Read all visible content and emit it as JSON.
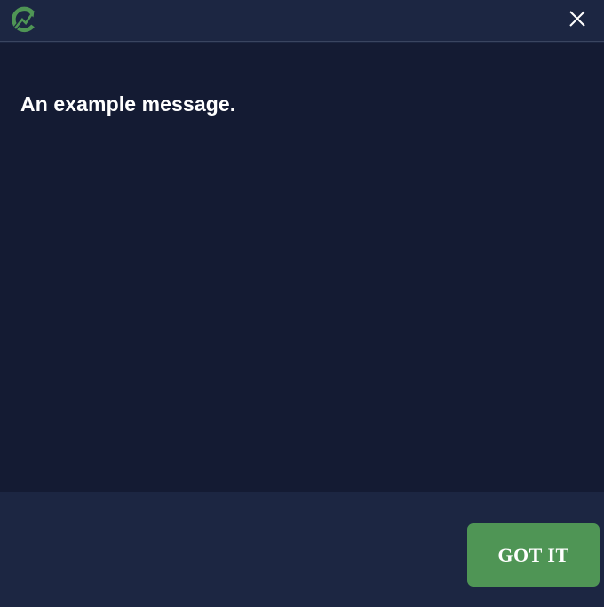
{
  "header": {
    "logo_icon": "brand-logo-icon",
    "close_icon": "close-icon"
  },
  "body": {
    "message": "An example message."
  },
  "footer": {
    "confirm_label": "GOT IT"
  },
  "colors": {
    "header_bg": "#1c2642",
    "body_bg": "#141b33",
    "accent_green": "#4f9555",
    "text": "#ffffff"
  }
}
